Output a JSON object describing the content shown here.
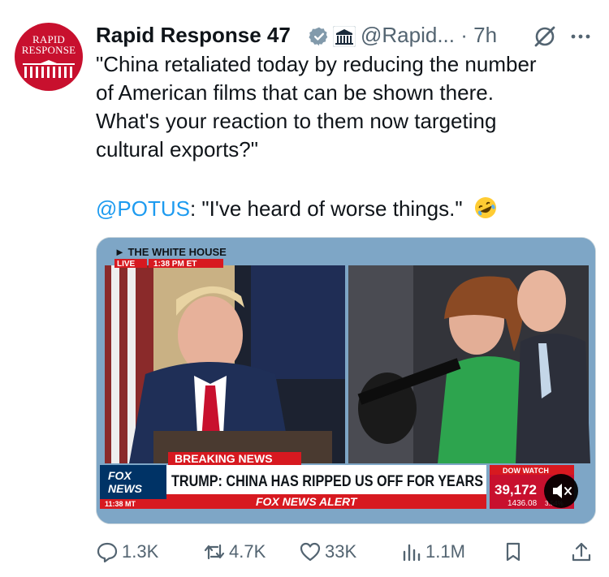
{
  "tweet": {
    "avatar_text_line1": "RAPID",
    "avatar_text_line2": "RESPONSE",
    "author_name": "Rapid Response 47",
    "handle": "@Rapid...",
    "separator": "·",
    "time": "7h",
    "text_lines": [
      "\"China retaliated today by reducing the number",
      "of American films that can be shown there.",
      "What's your reaction to them now targeting",
      "cultural exports?\""
    ],
    "reply_mention": "@POTUS",
    "reply_text": ": \"I've heard of worse things.\"",
    "emoji": "rolling-on-floor-laughing-emoji"
  },
  "media": {
    "network_label": "THE WHITE HOUSE",
    "live_label": "LIVE",
    "live_time": "1:38 PM ET",
    "breaking_label": "BREAKING NEWS",
    "headline": "TRUMP: CHINA HAS RIPPED US OFF FOR YEARS",
    "logo_line1": "FOX",
    "logo_line2": "NEWS",
    "clock": "11:38 MT",
    "alert_label": "FOX NEWS ALERT",
    "dow_label": "DOW WATCH",
    "dow_value": "39,172",
    "dow_change": "1436.08",
    "dow_pct": "3.54%"
  },
  "actions": {
    "replies": "1.3K",
    "reposts": "4.7K",
    "likes": "33K",
    "views": "1.1M"
  },
  "colors": {
    "text": "#0f1419",
    "secondary": "#536471",
    "link": "#1d9bf0",
    "verified": "#829aab",
    "fox_red": "#d71920",
    "fox_blue": "#003366"
  }
}
